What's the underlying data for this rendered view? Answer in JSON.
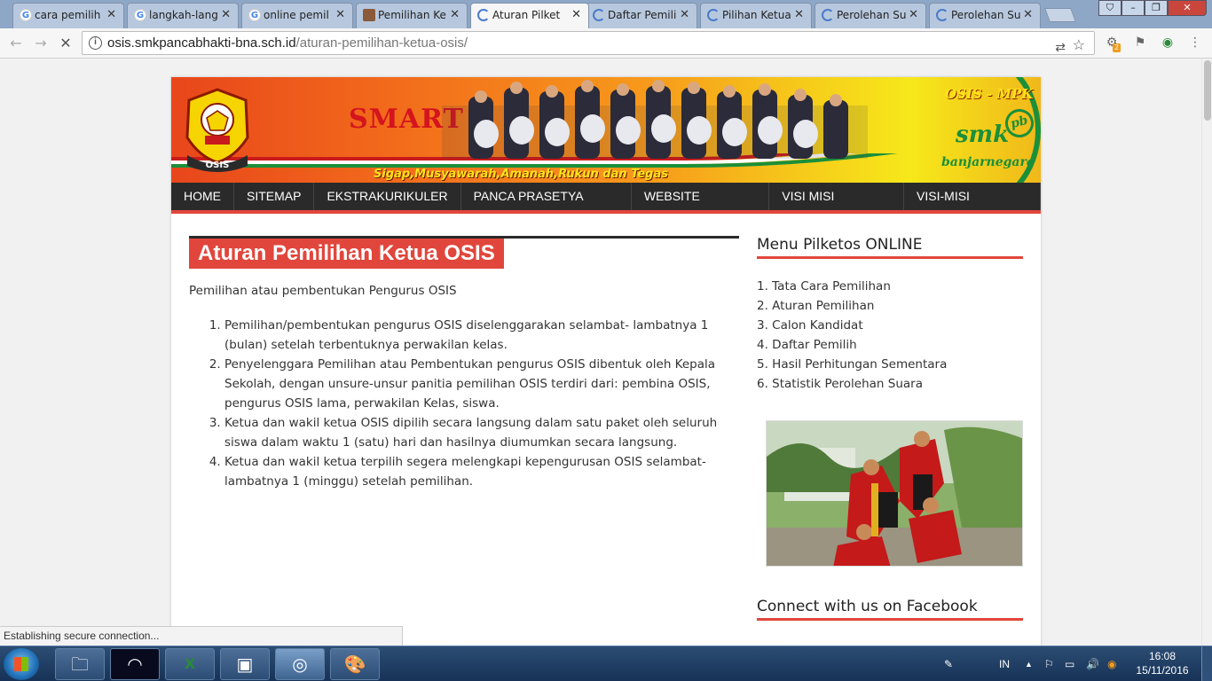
{
  "browser": {
    "tabs": [
      {
        "label": "cara pemilih",
        "favicon": "google"
      },
      {
        "label": "langkah-lang",
        "favicon": "google"
      },
      {
        "label": "online pemil",
        "favicon": "google"
      },
      {
        "label": "Pemilihan Ke",
        "favicon": "image"
      },
      {
        "label": "Aturan Pilket",
        "favicon": "loading",
        "active": true
      },
      {
        "label": "Daftar Pemili",
        "favicon": "loading"
      },
      {
        "label": "Pilihan Ketua",
        "favicon": "loading"
      },
      {
        "label": "Perolehan Su",
        "favicon": "loading"
      },
      {
        "label": "Perolehan Su",
        "favicon": "loading"
      }
    ],
    "url_host": "osis.smkpancabhakti-bna.sch.id",
    "url_path": "/aturan-pemilihan-ketua-osis/",
    "status_text": "Establishing secure connection...",
    "extension_badge": "2"
  },
  "site": {
    "banner": {
      "smart": "SMART",
      "tagline": "Sigap,Musyawarah,Amanah,Rukun dan Tegas",
      "osis_mpk": "OSIS - MPK",
      "smk": "smk",
      "pb": "pb",
      "city": "banjarnegara",
      "logo_text": "OSIS"
    },
    "nav": [
      "HOME",
      "SITEMAP",
      "EKSTRAKURIKULER",
      "PANCA PRASETYA SISWA",
      "WEBSITE SEKOLAH",
      "VISI MISI SEKOLAH",
      "VISI-MISI OSIS/MPK"
    ],
    "article": {
      "title": "Aturan Pemilihan Ketua OSIS",
      "intro": "Pemilihan atau pembentukan Pengurus OSIS",
      "rules": [
        "Pemilihan/pembentukan pengurus OSIS diselenggarakan selambat- lambatnya 1 (bulan) setelah terbentuknya perwakilan kelas.",
        "Penyelenggara Pemilihan atau Pembentukan pengurus OSIS dibentuk oleh Kepala Sekolah, dengan unsure-unsur panitia pemilihan OSIS terdiri dari: pembina OSIS, pengurus OSIS lama, perwakilan Kelas, siswa.",
        "Ketua dan wakil ketua OSIS dipilih secara langsung dalam satu paket oleh seluruh siswa dalam waktu 1 (satu) hari dan hasilnya diumumkan secara langsung.",
        "Ketua dan wakil ketua terpilih segera melengkapi kepengurusan OSIS selambat-lambatnya 1 (minggu) setelah pemilihan."
      ]
    },
    "sidebar": {
      "menu_title": "Menu Pilketos ONLINE",
      "menu_items": [
        "1. Tata Cara Pemilihan",
        "2. Aturan Pemilihan",
        "3. Calon Kandidat",
        "4. Daftar Pemilih",
        "5. Hasil Perhitungan Sementara",
        "6. Statistik Perolehan Suara"
      ],
      "facebook_title": "Connect with us on Facebook"
    }
  },
  "taskbar": {
    "apps": [
      "explorer-icon",
      "media-icon",
      "excel-icon",
      "virtualbox-icon",
      "chrome-icon",
      "paint-icon"
    ],
    "language": "IN",
    "time": "16:08",
    "date": "15/11/2016"
  },
  "colors": {
    "accent_red": "#e1463c",
    "nav_dark": "#2a2a2a",
    "tab_strip": "#8fa7c6",
    "taskbar": "#173256"
  }
}
